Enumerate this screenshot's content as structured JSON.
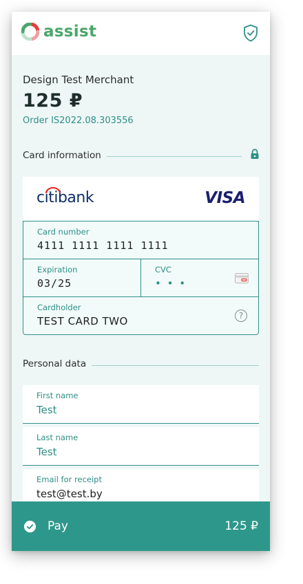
{
  "header": {
    "brand": "assist"
  },
  "merchant": {
    "name": "Design Test Merchant",
    "amount": "125 ₽",
    "order": "Order IS2022.08.303556"
  },
  "card_section": {
    "title": "Card information",
    "bank": "citibank",
    "network": "VISA",
    "card_number_label": "Card number",
    "card_number": "4111 1111 1111 1111",
    "expiration_label": "Expiration",
    "expiration": "03/25",
    "cvc_label": "CVC",
    "cvc": "• • •",
    "cardholder_label": "Cardholder",
    "cardholder": "TEST CARD TWO",
    "help": "?"
  },
  "personal_section": {
    "title": "Personal data",
    "first_name_label": "First name",
    "first_name": "Test",
    "last_name_label": "Last name",
    "last_name": "Test",
    "email_label": "Email for receipt",
    "email": "test@test.by"
  },
  "pay": {
    "label": "Pay",
    "amount": "125 ₽"
  },
  "colors": {
    "accent": "#2e978b",
    "brand_green": "#4aa66a",
    "background": "#eef7f6"
  }
}
